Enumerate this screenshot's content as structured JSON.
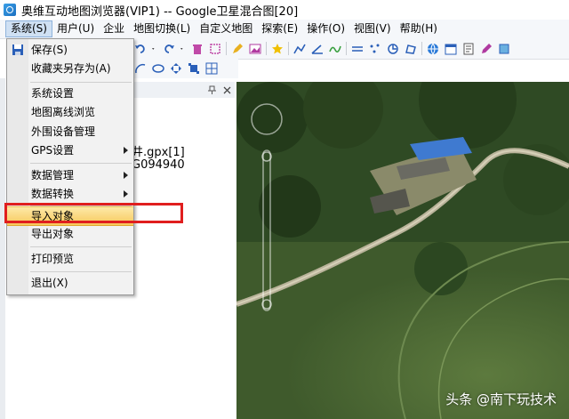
{
  "window": {
    "title": "奥维互动地图浏览器(VIP1) -- Google卫星混合图[20]"
  },
  "menubar": {
    "items": [
      {
        "label": "系统(S)",
        "active": true
      },
      {
        "label": "用户(U)"
      },
      {
        "label": "企业"
      },
      {
        "label": "地图切换(L)"
      },
      {
        "label": "自定义地图"
      },
      {
        "label": "探索(E)"
      },
      {
        "label": "操作(O)"
      },
      {
        "label": "视图(V)"
      },
      {
        "label": "帮助(H)"
      }
    ]
  },
  "system_menu": {
    "items": [
      {
        "label": "保存(S)",
        "icon": "save-icon"
      },
      {
        "label": "收藏夹另存为(A)"
      },
      {
        "label": "系统设置"
      },
      {
        "label": "地图离线浏览"
      },
      {
        "label": "外围设备管理"
      },
      {
        "label": "GPS设置",
        "submenu": true
      },
      {
        "label": "数据管理",
        "submenu": true
      },
      {
        "label": "数据转换",
        "submenu": true
      },
      {
        "label": "导入对象",
        "highlighted": true
      },
      {
        "label": "导出对象"
      },
      {
        "label": "打印预览"
      },
      {
        "label": "退出(X)"
      }
    ]
  },
  "left_panel": {
    "pin_icon": "pin-icon",
    "close_icon": "close-icon",
    "lines": [
      "井.gpx[1]",
      "G094940"
    ]
  },
  "watermark": "头条 @南下玩技术",
  "colors": {
    "menu_highlight": "#f7c85a",
    "annotation_red": "#e01e1e",
    "menu_active": "#cfe0f3"
  }
}
